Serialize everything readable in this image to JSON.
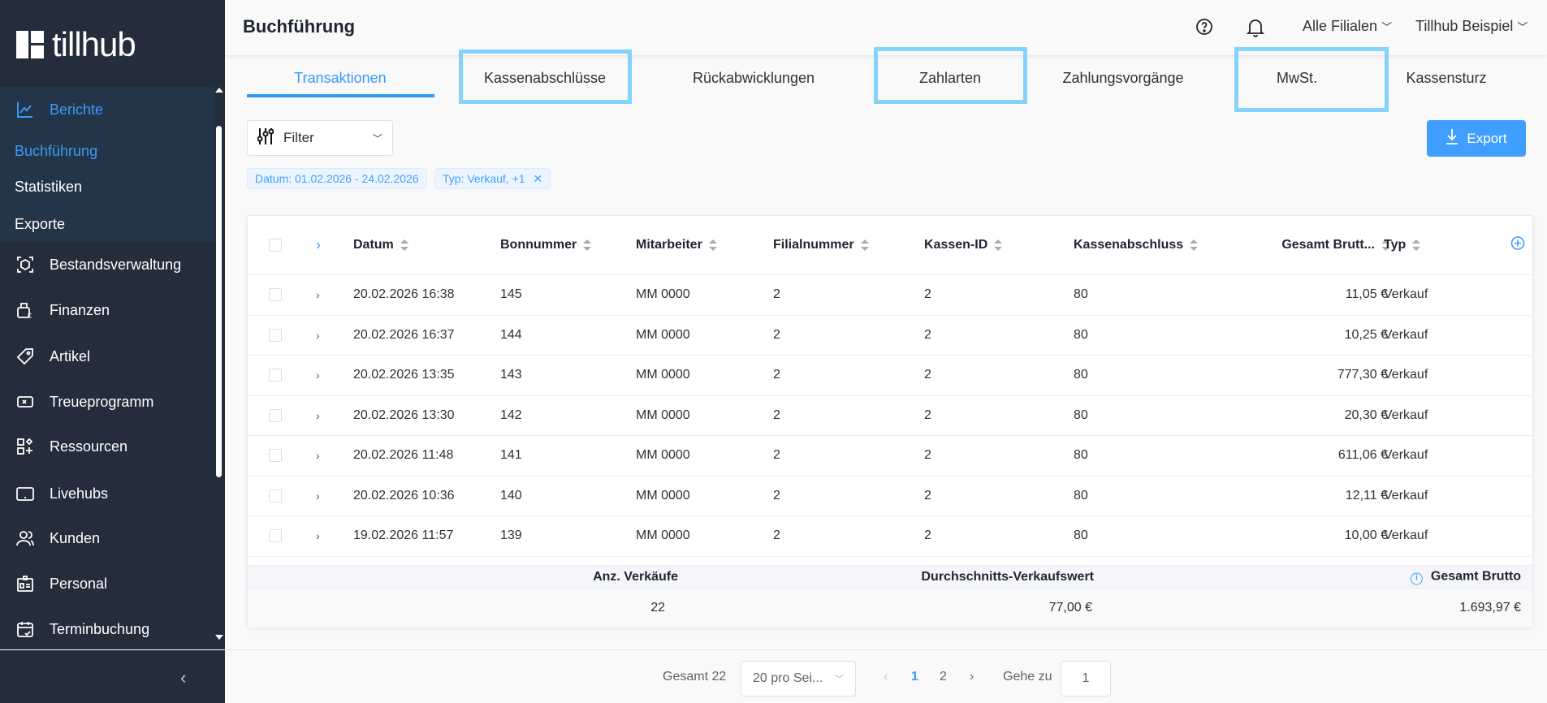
{
  "brand": {
    "name": "tillhub"
  },
  "sidebar": {
    "sections": [
      {
        "label": "Berichte",
        "icon": "chart-line-icon",
        "active": true,
        "items": [
          {
            "label": "Buchführung",
            "active": true
          },
          {
            "label": "Statistiken"
          },
          {
            "label": "Exporte"
          }
        ]
      },
      {
        "label": "Bestandsverwaltung",
        "icon": "inventory-box-icon"
      },
      {
        "label": "Finanzen",
        "icon": "cash-register-euro-icon"
      },
      {
        "label": "Artikel",
        "icon": "tag-icon"
      },
      {
        "label": "Treueprogramm",
        "icon": "gift-card-icon"
      },
      {
        "label": "Ressourcen",
        "icon": "resources-grid-icon"
      },
      {
        "label": "Livehubs",
        "icon": "tablet-icon"
      },
      {
        "label": "Kunden",
        "icon": "users-icon"
      },
      {
        "label": "Personal",
        "icon": "id-badge-icon"
      },
      {
        "label": "Terminbuchung",
        "icon": "calendar-check-icon"
      }
    ]
  },
  "header": {
    "title": "Buchführung",
    "branch_select": "Alle Filialen",
    "account_select": "Tillhub Beispiel"
  },
  "tabs": [
    {
      "label": "Transaktionen",
      "active": true
    },
    {
      "label": "Kassenabschlüsse",
      "highlighted": true
    },
    {
      "label": "Rückabwicklungen"
    },
    {
      "label": "Zahlarten",
      "highlighted": true
    },
    {
      "label": "Zahlungsvorgänge"
    },
    {
      "label": "MwSt.",
      "highlighted": true
    },
    {
      "label": "Kassensturz"
    }
  ],
  "toolbar": {
    "filter_label": "Filter",
    "export_label": "Export",
    "chips": [
      "Datum: 01.02.2026 - 24.02.2026",
      "Typ: Verkauf, +1"
    ]
  },
  "table": {
    "columns": [
      "Datum",
      "Bonnummer",
      "Mitarbeiter",
      "Filialnummer",
      "Kassen-ID",
      "Kassenabschluss",
      "Gesamt Brutt...",
      "Typ"
    ],
    "rows": [
      [
        "20.02.2026 16:38",
        "145",
        "MM 0000",
        "2",
        "2",
        "80",
        "11,05 €",
        "Verkauf"
      ],
      [
        "20.02.2026 16:37",
        "144",
        "MM 0000",
        "2",
        "2",
        "80",
        "10,25 €",
        "Verkauf"
      ],
      [
        "20.02.2026 13:35",
        "143",
        "MM 0000",
        "2",
        "2",
        "80",
        "777,30 €",
        "Verkauf"
      ],
      [
        "20.02.2026 13:30",
        "142",
        "MM 0000",
        "2",
        "2",
        "80",
        "20,30 €",
        "Verkauf"
      ],
      [
        "20.02.2026 11:48",
        "141",
        "MM 0000",
        "2",
        "2",
        "80",
        "611,06 €",
        "Verkauf"
      ],
      [
        "20.02.2026 10:36",
        "140",
        "MM 0000",
        "2",
        "2",
        "80",
        "12,11 €",
        "Verkauf"
      ],
      [
        "19.02.2026 11:57",
        "139",
        "MM 0000",
        "2",
        "2",
        "80",
        "10,00 €",
        "Verkauf"
      ]
    ],
    "summary": {
      "labels": {
        "count": "Anz. Verkäufe",
        "avg": "Durchschnitts-Verkaufswert",
        "total": "Gesamt Brutto"
      },
      "values": {
        "count": "22",
        "avg": "77,00 €",
        "total": "1.693,97 €"
      }
    }
  },
  "pagination": {
    "total_label": "Gesamt 22",
    "page_size": "20 pro Sei...",
    "pages": [
      "1",
      "2"
    ],
    "current": "1",
    "goto_label": "Gehe zu",
    "goto_value": "1"
  },
  "colors": {
    "accent": "#409eff",
    "sidebar": "#232d3b",
    "highlight": "#85d2fb"
  }
}
